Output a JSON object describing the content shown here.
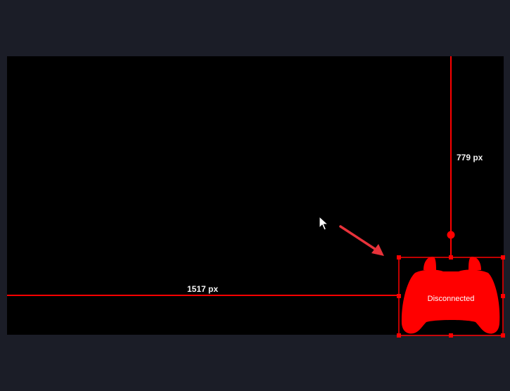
{
  "measurements": {
    "horizontal_label": "1517 px",
    "vertical_label": "779 px"
  },
  "controller": {
    "status_label": "Disconnected",
    "icon": "gamepad-icon"
  },
  "colors": {
    "background": "#1b1d27",
    "canvas": "#000000",
    "accent": "#ff0000",
    "arrow": "#e8323a"
  }
}
